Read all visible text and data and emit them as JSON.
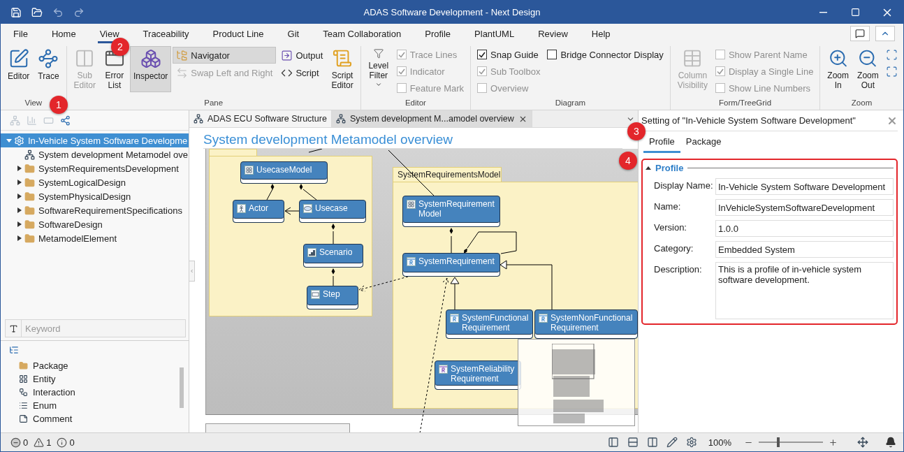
{
  "window": {
    "title": "ADAS Software Development - Next Design"
  },
  "menu": [
    {
      "label": "File",
      "selected": false
    },
    {
      "label": "Home",
      "selected": false
    },
    {
      "label": "View",
      "selected": true
    },
    {
      "label": "Traceability",
      "selected": false
    },
    {
      "label": "Product Line",
      "selected": false
    },
    {
      "label": "Git",
      "selected": false
    },
    {
      "label": "Team Collaboration",
      "selected": false
    },
    {
      "label": "Profile",
      "selected": false
    },
    {
      "label": "PlantUML",
      "selected": false
    },
    {
      "label": "Review",
      "selected": false
    },
    {
      "label": "Help",
      "selected": false
    }
  ],
  "ribbon": {
    "groups": [
      {
        "label": "View",
        "columns": [
          [
            {
              "kind": "large",
              "label": "Editor",
              "disabled": false,
              "on": false
            }
          ],
          [
            {
              "kind": "large",
              "label": "Trace",
              "disabled": false,
              "on": false
            }
          ]
        ]
      },
      {
        "label": "Pane",
        "columns": [
          [
            {
              "kind": "large",
              "label": "Sub\nEditor",
              "disabled": true,
              "on": false
            }
          ],
          [
            {
              "kind": "large",
              "label": "Error\nList",
              "disabled": false,
              "on": false
            }
          ],
          [
            {
              "kind": "large",
              "label": "Inspector",
              "disabled": false,
              "on": true
            }
          ],
          [
            {
              "kind": "small",
              "label": "Navigator",
              "disabled": false,
              "on": true
            },
            {
              "kind": "small",
              "label": "Swap Left and Right",
              "disabled": true,
              "on": false
            }
          ],
          [
            {
              "kind": "small",
              "label": "Output",
              "disabled": false,
              "on": false
            },
            {
              "kind": "small",
              "label": "Script",
              "disabled": false,
              "on": false
            }
          ],
          [
            {
              "kind": "large",
              "label": "Script\nEditor",
              "disabled": false,
              "on": false
            }
          ]
        ]
      },
      {
        "label": "Editor",
        "columns": [
          [
            {
              "kind": "large",
              "label": "Level\nFilter",
              "disabled": false,
              "on": false,
              "dropdown": true
            }
          ],
          [
            {
              "kind": "check",
              "label": "Trace Lines",
              "disabled": true,
              "checked": true
            },
            {
              "kind": "check",
              "label": "Indicator",
              "disabled": true,
              "checked": true
            },
            {
              "kind": "check",
              "label": "Feature Mark",
              "disabled": true,
              "checked": false
            }
          ]
        ]
      },
      {
        "label": "Diagram",
        "columns": [
          [
            {
              "kind": "check",
              "label": "Snap Guide",
              "disabled": false,
              "checked": true
            },
            {
              "kind": "check",
              "label": "Sub Toolbox",
              "disabled": true,
              "checked": true
            },
            {
              "kind": "check",
              "label": "Overview",
              "disabled": true,
              "checked": false
            }
          ],
          [
            {
              "kind": "check",
              "label": "Bridge Connector Display",
              "disabled": false,
              "checked": false
            }
          ]
        ]
      },
      {
        "label": "Form/TreeGrid",
        "columns": [
          [
            {
              "kind": "large",
              "label": "Column\nVisibility",
              "disabled": true,
              "on": false
            }
          ],
          [
            {
              "kind": "check",
              "label": "Show Parent Name",
              "disabled": true,
              "checked": false
            },
            {
              "kind": "check",
              "label": "Display a Single Line",
              "disabled": true,
              "checked": true
            },
            {
              "kind": "check",
              "label": "Show Line Numbers",
              "disabled": true,
              "checked": false
            }
          ]
        ]
      },
      {
        "label": "Zoom",
        "columns": [
          [
            {
              "kind": "large",
              "label": "Zoom\nIn",
              "disabled": false,
              "on": false
            }
          ],
          [
            {
              "kind": "large",
              "label": "Zoom\nOut",
              "disabled": false,
              "on": false
            }
          ],
          [
            {
              "kind": "icon",
              "disabled": false,
              "on": false
            },
            {
              "kind": "icon",
              "disabled": false,
              "on": false
            }
          ]
        ]
      }
    ]
  },
  "tree": {
    "items": [
      {
        "label": "In-Vehicle System Software Developme",
        "kind": "profile",
        "selected": true,
        "expanded": true,
        "children": [
          {
            "label": "System development Metamodel ove",
            "kind": "diagram",
            "selected": false
          },
          {
            "label": "SystemRequirementsDevelopment",
            "kind": "folder",
            "selected": false,
            "expanded": false
          },
          {
            "label": "SystemLogicalDesign",
            "kind": "folder",
            "selected": false,
            "expanded": false
          },
          {
            "label": "SystemPhysicalDesign",
            "kind": "folder",
            "selected": false,
            "expanded": false
          },
          {
            "label": "SoftwareRequirementSpecifications",
            "kind": "folder",
            "selected": false,
            "expanded": false
          },
          {
            "label": "SoftwareDesign",
            "kind": "folder",
            "selected": false,
            "expanded": false
          },
          {
            "label": "MetamodelElement",
            "kind": "folder",
            "selected": false,
            "expanded": false
          }
        ]
      }
    ]
  },
  "search": {
    "placeholder": "Keyword"
  },
  "toolbox": {
    "items": [
      {
        "label": "Package"
      },
      {
        "label": "Entity"
      },
      {
        "label": "Interaction"
      },
      {
        "label": "Enum"
      },
      {
        "label": "Comment"
      }
    ]
  },
  "editor": {
    "tabs": [
      {
        "label": "ADAS ECU Software Structure",
        "selected": false
      },
      {
        "label": "System development M...amodel overview",
        "selected": true
      }
    ],
    "title": "System development Metamodel overview",
    "packages": [
      {
        "kind": "package"
      },
      {
        "kind": "package",
        "label": "SystemRequirementsModel"
      }
    ],
    "nodes": [
      {
        "label": "UsecaseModel",
        "kind": "model"
      },
      {
        "label": "Actor",
        "kind": "actor"
      },
      {
        "label": "Usecase",
        "kind": "usecase"
      },
      {
        "label": "Scenario",
        "kind": "scenario"
      },
      {
        "label": "Step",
        "kind": "step"
      },
      {
        "label": "SystemRequirement\nModel",
        "kind": "model"
      },
      {
        "label": "SystemRequirement",
        "kind": "requirement"
      },
      {
        "label": "SystemFunctional\nRequirement",
        "kind": "requirement"
      },
      {
        "label": "SystemNonFunctional\nRequirement",
        "kind": "requirement"
      },
      {
        "label": "SystemReliability\nRequirement",
        "kind": "reliability"
      }
    ]
  },
  "inspector": {
    "title": "Setting of \"In-Vehicle System Software Development\"",
    "tabs": [
      {
        "label": "Profile",
        "selected": true
      },
      {
        "label": "Package",
        "selected": false
      }
    ],
    "section": {
      "title": "Profile",
      "expanded": true,
      "fields": [
        {
          "label": "Display Name:",
          "value": "In-Vehicle System Software Development",
          "kind": "text"
        },
        {
          "label": "Name:",
          "value": "InVehicleSystemSoftwareDevelopment",
          "kind": "text"
        },
        {
          "label": "Version:",
          "value": "1.0.0",
          "kind": "text"
        },
        {
          "label": "Category:",
          "value": "Embedded System",
          "kind": "text"
        },
        {
          "label": "Description:",
          "value": "This is a profile of in-vehicle system software development.",
          "kind": "multiline"
        }
      ]
    }
  },
  "status": {
    "errors": "0",
    "warnings": "1",
    "infos": "0",
    "zoom": "100%",
    "zoom_slider": {
      "level": 0.3
    }
  },
  "callouts": [
    {
      "label": "1"
    },
    {
      "label": "2"
    },
    {
      "label": "3"
    },
    {
      "label": "4"
    }
  ]
}
